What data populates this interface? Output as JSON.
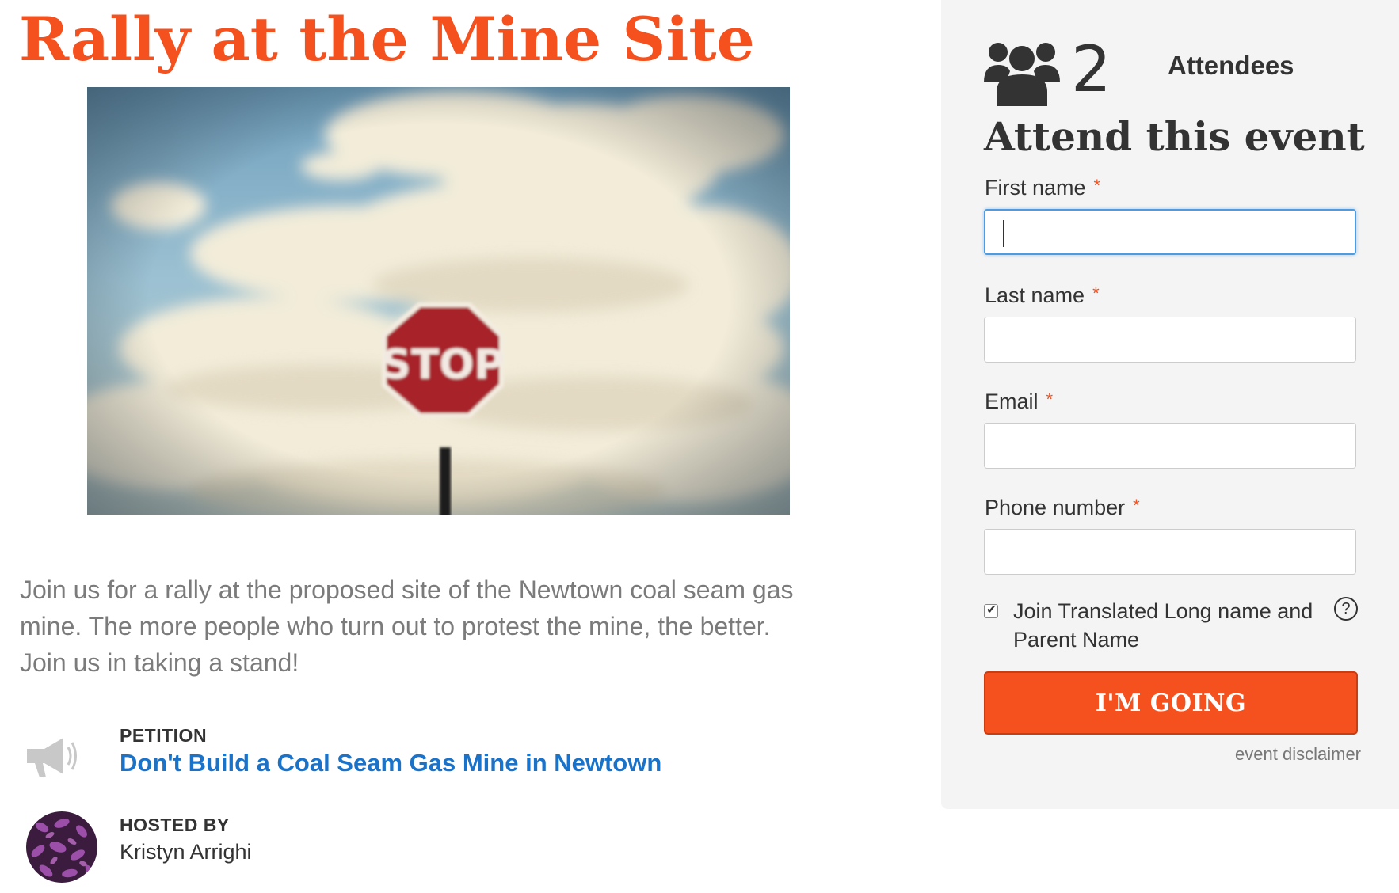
{
  "event": {
    "title": "Rally at the Mine Site",
    "description": "Join us for a rally at the proposed site of the Newtown coal seam gas mine. The more people who turn out to protest the mine, the better. Join us in taking a stand!",
    "image_sign_text": "STOP"
  },
  "petition": {
    "label": "PETITION",
    "link_text": "Don't Build a Coal Seam Gas Mine in Newtown",
    "icon": "megaphone-icon"
  },
  "host": {
    "label": "HOSTED BY",
    "name": "Kristyn Arrighi"
  },
  "sidebar": {
    "attendee_count": "2",
    "attendee_label": "Attendees",
    "form_heading": "Attend this event",
    "required_marker": "*",
    "fields": {
      "first_name": {
        "label": "First name",
        "value": ""
      },
      "last_name": {
        "label": "Last name",
        "value": ""
      },
      "email": {
        "label": "Email",
        "value": ""
      },
      "phone": {
        "label": "Phone number",
        "value": ""
      }
    },
    "join_checkbox": {
      "label": "Join Translated Long name and Parent Name",
      "checked": true
    },
    "help_icon": "?",
    "submit_label": "I'M GOING",
    "disclaimer_link": "event disclaimer"
  },
  "colors": {
    "brand_orange": "#f4511e",
    "link_blue": "#1a73c8",
    "sidebar_bg": "#f4f4f4",
    "focus_blue": "#4d9be0"
  }
}
